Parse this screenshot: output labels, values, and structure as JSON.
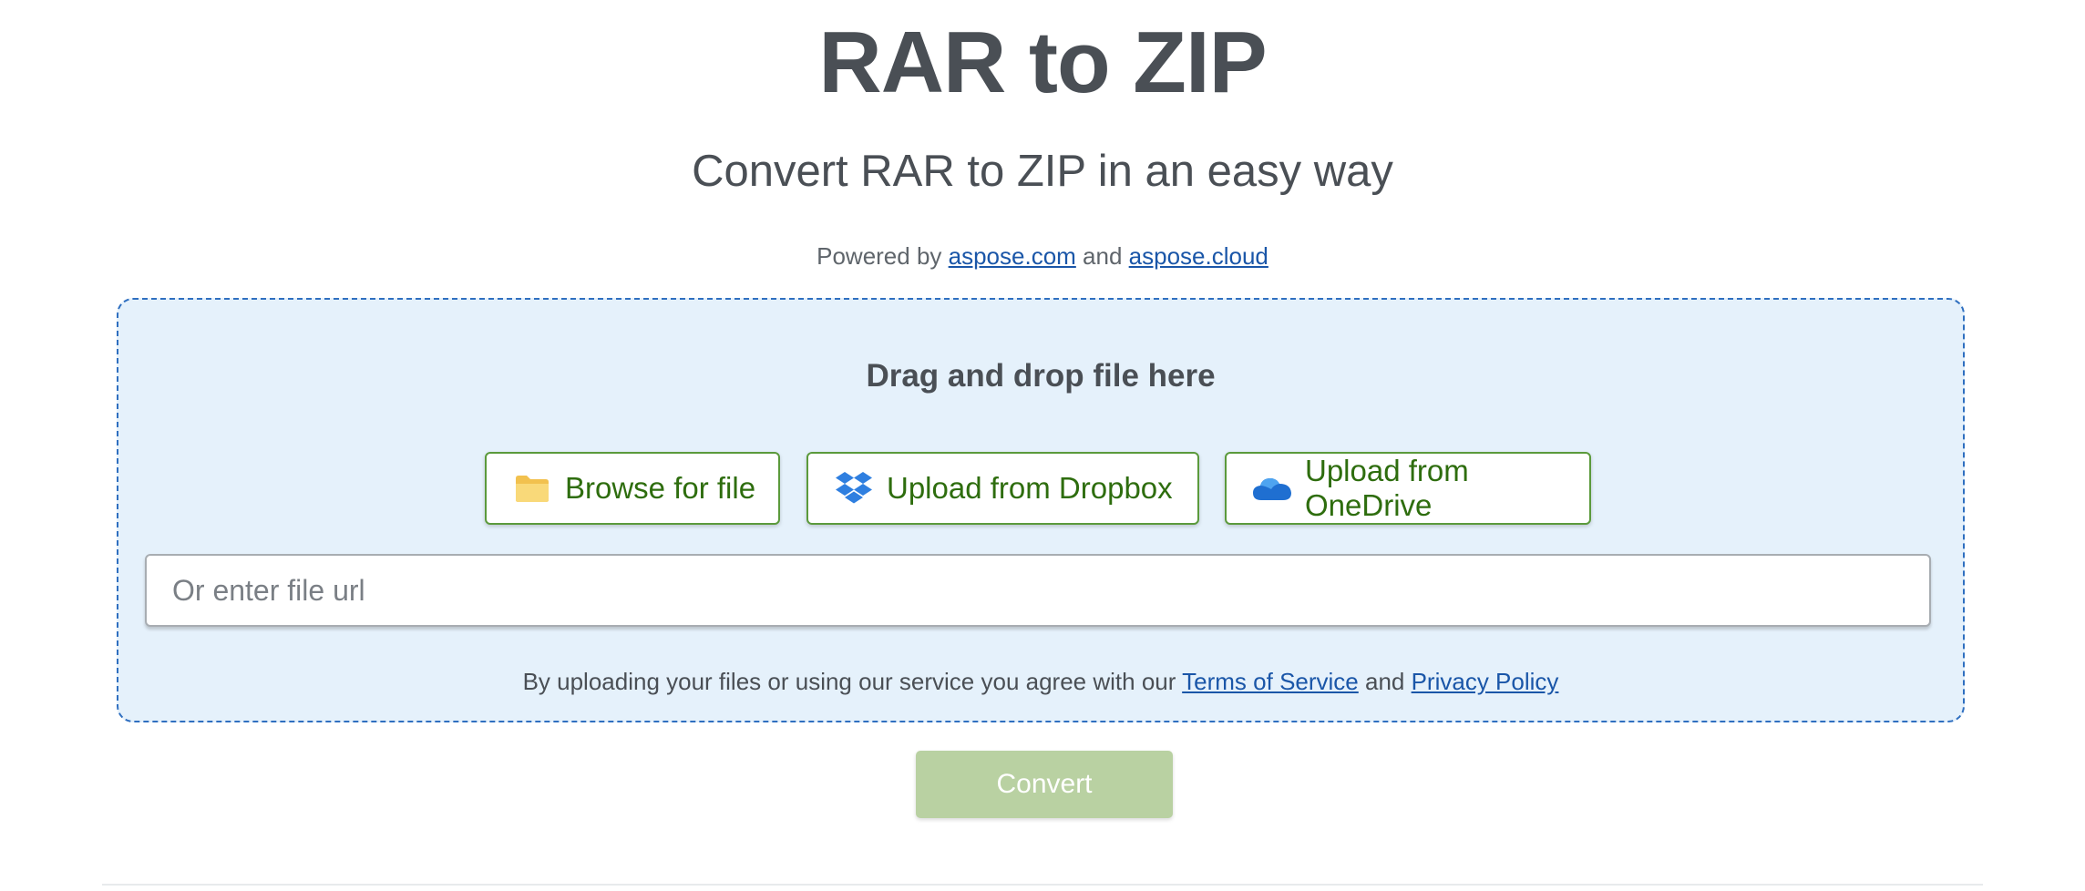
{
  "header": {
    "title": "RAR to ZIP",
    "subtitle": "Convert RAR to ZIP in an easy way",
    "powered_prefix": "Powered by ",
    "powered_link1": "aspose.com",
    "powered_and": " and ",
    "powered_link2": "aspose.cloud"
  },
  "dropzone": {
    "label": "Drag and drop file here",
    "buttons": [
      {
        "label": "Browse for file",
        "icon": "folder-icon"
      },
      {
        "label": "Upload from Dropbox",
        "icon": "dropbox-icon"
      },
      {
        "label": "Upload from OneDrive",
        "icon": "onedrive-icon"
      }
    ],
    "url_placeholder": "Or enter file url",
    "terms_prefix": "By uploading your files or using our service you agree with our ",
    "terms_link": "Terms of Service",
    "terms_and": " and ",
    "privacy_link": "Privacy Policy"
  },
  "convert": {
    "label": "Convert"
  },
  "colors": {
    "accent_green": "#2e6d0e",
    "dropzone_bg": "#e5f1fb",
    "link_blue": "#1a56a8",
    "convert_disabled": "#b9d1a2"
  }
}
